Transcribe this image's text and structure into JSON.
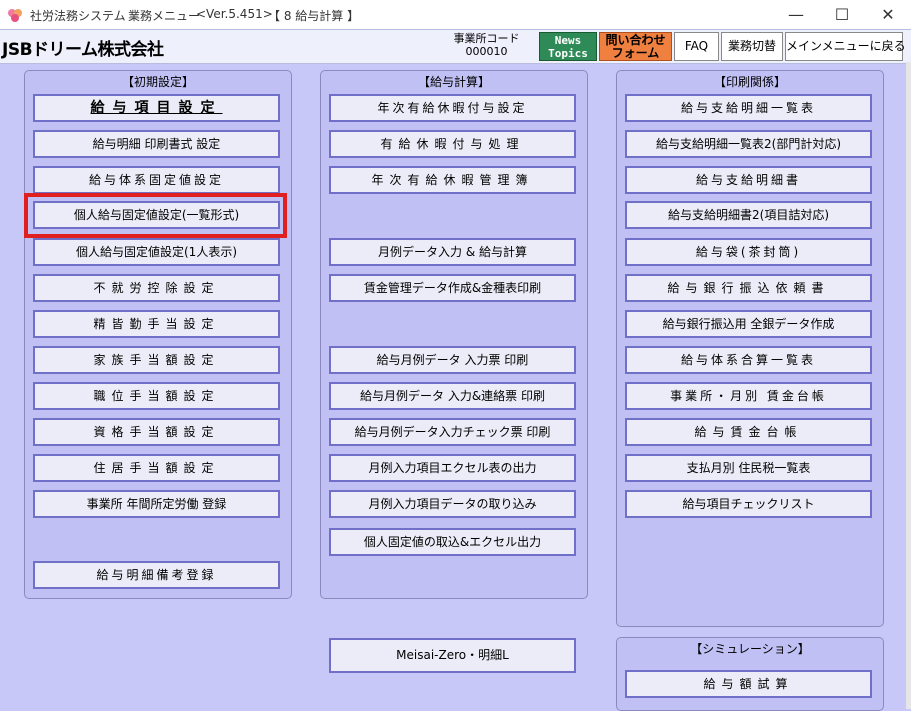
{
  "titlebar": {
    "app_name": "社労法務システム",
    "menu_name": "業務メニュー",
    "version": "<Ver.5.451>",
    "section": "【 8  給与計算 】",
    "controls": [
      "—",
      "☐",
      "✕"
    ]
  },
  "header": {
    "company": "JSBドリーム株式会社",
    "office_code_label": "事業所コード",
    "office_code": "000010",
    "news_line1": "News",
    "news_line2": "Topics",
    "contact_line1": "問い合わせ",
    "contact_line2": "フォーム",
    "faq": "FAQ",
    "switch": "業務切替",
    "main_menu": "メインメニューに戻る",
    "colors": {
      "news": "#2e8b57",
      "contact": "#f08040"
    }
  },
  "groups": {
    "initial": {
      "title": "【初期設定】",
      "buttons": [
        "給与項目設定",
        "給与明細 印刷書式 設定",
        "給与体系固定値設定",
        "個人給与固定値設定(一覧形式)",
        "個人給与固定値設定(1人表示)",
        "不就労控除設定",
        "精皆勤手当設定",
        "家族手当額設定",
        "職位手当額設定",
        "資格手当額設定",
        "住居手当額設定",
        "事業所 年間所定労働 登録",
        "給与明細備考登録"
      ]
    },
    "payroll": {
      "title": "【給与計算】",
      "buttons": [
        "年次有給休暇付与設定",
        "有給休暇付与処理",
        "年次有給休暇管理簿",
        "月例データ入力 & 給与計算",
        "賃金管理データ作成&金種表印刷",
        "給与月例データ 入力票 印刷",
        "給与月例データ 入力&連絡票 印刷",
        "給与月例データ入力チェック票 印刷",
        "月例入力項目エクセル表の出力",
        "月例入力項目データの取り込み",
        "個人固定値の取込&エクセル出力"
      ]
    },
    "printing": {
      "title": "【印刷関係】",
      "buttons": [
        "給与支給明細一覧表",
        "給与支給明細一覧表2(部門計対応)",
        "給与支給明細書",
        "給与支給明細書2(項目詰対応)",
        "給与袋(茶封筒)",
        "給与銀行振込依頼書",
        "給与銀行振込用 全銀データ作成",
        "給与体系合算一覧表",
        "事業所・月別 賃金台帳",
        "給与賃金台帳",
        "支払月別 住民税一覧表",
        "給与項目チェックリスト"
      ]
    },
    "simulation": {
      "title": "【シミュレーション】",
      "buttons": [
        "給与額試算"
      ]
    }
  },
  "standalone": {
    "meisai": "Meisai-Zero・明細L"
  },
  "highlight_color": "#e02020"
}
